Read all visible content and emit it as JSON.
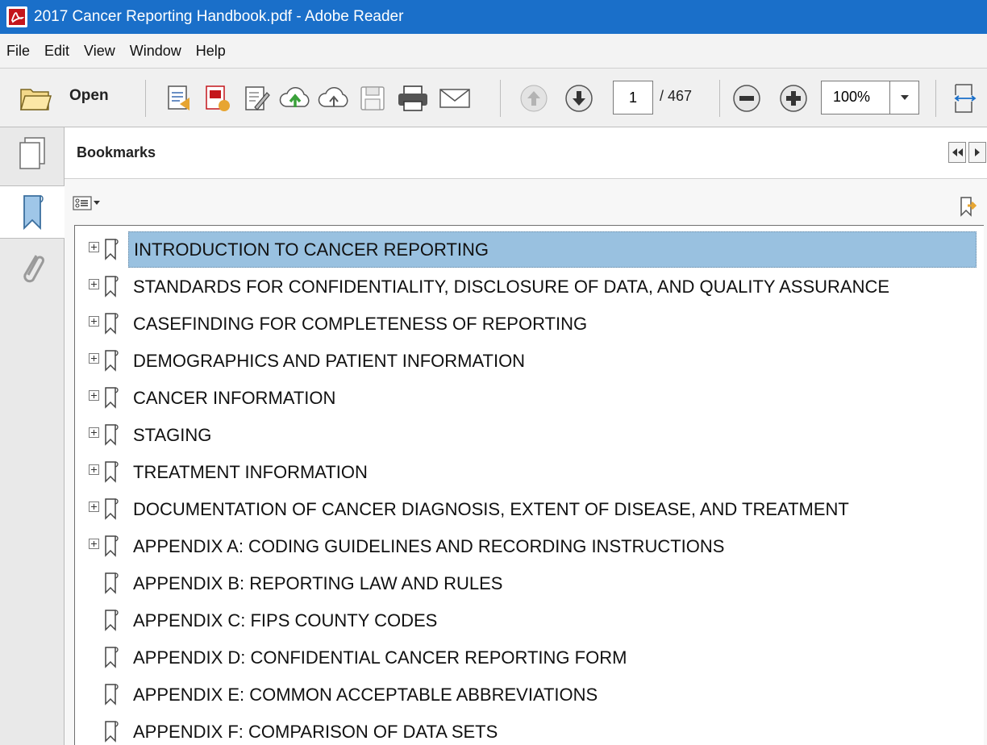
{
  "window": {
    "title": "2017 Cancer Reporting Handbook.pdf - Adobe Reader",
    "app_icon": "pdf-app-icon"
  },
  "menu": [
    "File",
    "Edit",
    "View",
    "Window",
    "Help"
  ],
  "toolbar": {
    "open_label": "Open",
    "page_current": "1",
    "page_total": "/ 467",
    "zoom": "100%"
  },
  "panel": {
    "title": "Bookmarks"
  },
  "bookmarks": [
    {
      "label": "INTRODUCTION TO CANCER REPORTING",
      "expandable": true,
      "selected": true
    },
    {
      "label": "STANDARDS FOR CONFIDENTIALITY, DISCLOSURE OF DATA, AND QUALITY ASSURANCE",
      "expandable": true,
      "selected": false
    },
    {
      "label": "CASEFINDING FOR COMPLETENESS OF REPORTING",
      "expandable": true,
      "selected": false
    },
    {
      "label": "DEMOGRAPHICS AND PATIENT INFORMATION",
      "expandable": true,
      "selected": false
    },
    {
      "label": "CANCER INFORMATION",
      "expandable": true,
      "selected": false
    },
    {
      "label": "STAGING",
      "expandable": true,
      "selected": false
    },
    {
      "label": "TREATMENT INFORMATION",
      "expandable": true,
      "selected": false
    },
    {
      "label": "DOCUMENTATION OF CANCER DIAGNOSIS, EXTENT OF DISEASE, AND TREATMENT",
      "expandable": true,
      "selected": false
    },
    {
      "label": "APPENDIX A:  CODING GUIDELINES AND RECORDING INSTRUCTIONS",
      "expandable": true,
      "selected": false
    },
    {
      "label": "APPENDIX B:  REPORTING LAW AND RULES",
      "expandable": false,
      "selected": false
    },
    {
      "label": "APPENDIX C:  FIPS COUNTY CODES",
      "expandable": false,
      "selected": false
    },
    {
      "label": "APPENDIX D:  CONFIDENTIAL CANCER REPORTING FORM",
      "expandable": false,
      "selected": false
    },
    {
      "label": "APPENDIX E:  COMMON ACCEPTABLE ABBREVIATIONS",
      "expandable": false,
      "selected": false
    },
    {
      "label": "APPENDIX F:  COMPARISON OF DATA SETS",
      "expandable": false,
      "selected": false
    }
  ]
}
